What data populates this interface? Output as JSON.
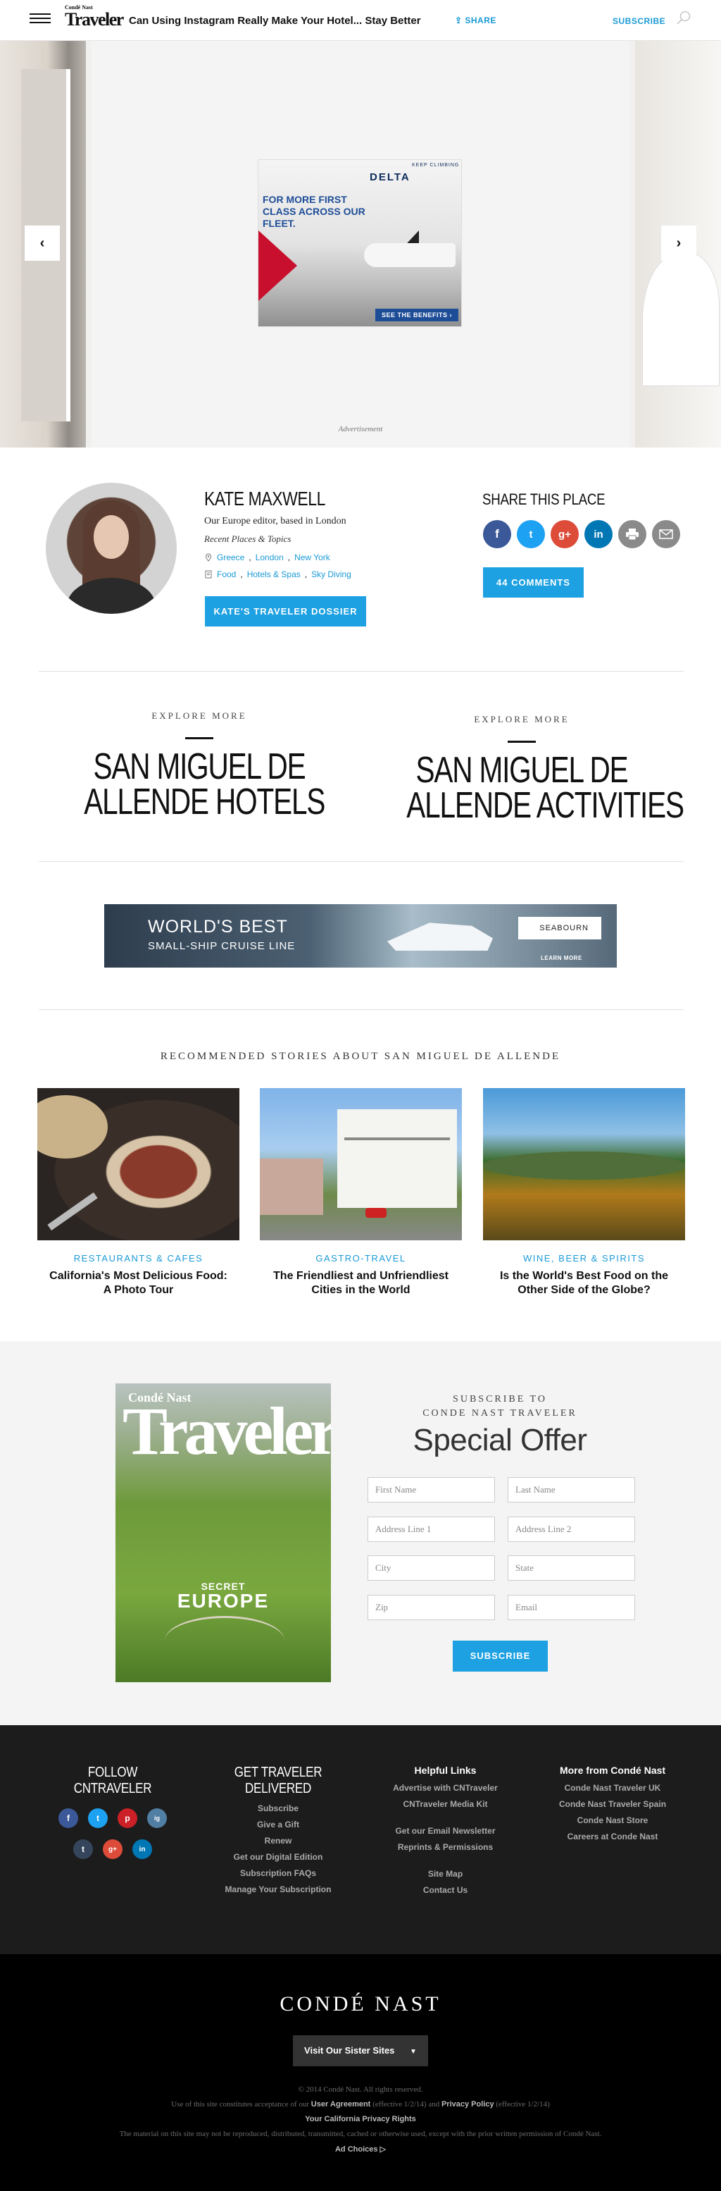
{
  "header": {
    "logo_top": "Condé Nast",
    "logo_main": "Traveler",
    "title": "Can Using Instagram Really Make Your Hotel... Stay Better",
    "share_label": "SHARE",
    "subscribe_label": "SUBSCRIBE"
  },
  "slideshow": {
    "prev_label": "‹",
    "next_label": "›",
    "ad_label": "Advertisement",
    "delta_ad": {
      "keep_climbing": "KEEP CLIMBING",
      "brand": "DELTA",
      "headline": "FOR MORE FIRST CLASS ACROSS OUR FLEET.",
      "cta": "SEE THE BENEFITS ›"
    }
  },
  "author": {
    "name": "KATE MAXWELL",
    "bio": "Our Europe editor, based in London",
    "recent_label": "Recent Places & Topics",
    "places": [
      "Greece",
      "London",
      "New York"
    ],
    "topics": [
      "Food",
      "Hotels & Spas",
      "Sky Diving"
    ],
    "dossier_button": "KATE'S TRAVELER DOSSIER"
  },
  "share": {
    "title": "SHARE THIS PLACE",
    "buttons": [
      "f",
      "t",
      "g+",
      "in",
      "print",
      "email"
    ],
    "comments_button": "44 COMMENTS"
  },
  "explore": [
    {
      "kicker": "EXPLORE MORE",
      "line1": "SAN MIGUEL DE",
      "line2": "ALLENDE HOTELS"
    },
    {
      "kicker": "EXPLORE MORE",
      "line1": "SAN MIGUEL DE",
      "line2": "ALLENDE ACTIVITIES"
    }
  ],
  "seabourn_ad": {
    "line1": "WORLD'S BEST",
    "line2": "SMALL-SHIP CRUISE LINE",
    "brand": "SEABOURN",
    "cta": "LEARN MORE"
  },
  "recommended": {
    "title": "RECOMMENDED STORIES ABOUT SAN MIGUEL DE ALLENDE",
    "cards": [
      {
        "category": "RESTAURANTS & CAFES",
        "title": "California's Most Delicious Food: A Photo Tour"
      },
      {
        "category": "GASTRO-TRAVEL",
        "title": "The Friendliest and Unfriendliest Cities in the World"
      },
      {
        "category": "WINE, BEER & SPIRITS",
        "title": "Is the World's Best Food on the Other Side of the Globe?"
      }
    ]
  },
  "subscribe": {
    "kicker_line1": "SUBSCRIBE TO",
    "kicker_line2": "CONDE NAST TRAVELER",
    "title": "Special Offer",
    "cover": {
      "top": "Condé Nast",
      "main": "Traveler",
      "secret": "SECRET",
      "europe": "EUROPE"
    },
    "fields": {
      "first_name": "First Name",
      "last_name": "Last Name",
      "address1": "Address Line 1",
      "address2": "Address Line 2",
      "city": "City",
      "state": "State",
      "zip": "Zip",
      "email": "Email"
    },
    "button": "SUBSCRIBE"
  },
  "footer": {
    "follow_line1": "FOLLOW",
    "follow_line2": "CNTRAVELER",
    "social": [
      "f",
      "t",
      "p",
      "ig",
      "t",
      "g+",
      "in"
    ],
    "delivered_line1": "GET TRAVELER",
    "delivered_line2": "DELIVERED",
    "delivered_links": [
      "Subscribe",
      "Give a Gift",
      "Renew",
      "Get our Digital Edition",
      "Subscription FAQs",
      "Manage Your Subscription"
    ],
    "helpful_title": "Helpful Links",
    "helpful_links": [
      "Advertise with CNTraveler",
      "CNTraveler Media Kit",
      "Get our Email Newsletter",
      "Reprints & Permissions",
      "Site Map",
      "Contact Us"
    ],
    "more_title": "More from Condé Nast",
    "more_links": [
      "Conde Nast Traveler UK",
      "Conde Nast Traveler Spain",
      "Conde Nast Store",
      "Careers at Conde Nast"
    ],
    "cn_logo": "CONDÉ NAST",
    "sister_sites": "Visit Our Sister Sites",
    "copyright": "© 2014 Condé Nast. All rights reserved.",
    "legal_a": "Use of this site constitutes acceptance of our",
    "user_agreement": "User Agreement",
    "legal_b": "(effective 1/2/14) and",
    "privacy_policy": "Privacy Policy",
    "legal_c": "(effective 1/2/14)",
    "ca_privacy": "Your California Privacy Rights",
    "material": "The material on this site may not be reproduced, distributed, transmitted, cached or otherwise used, except with the prior written permission of Condé Nast.",
    "ad_choices": "Ad Choices ▷"
  }
}
